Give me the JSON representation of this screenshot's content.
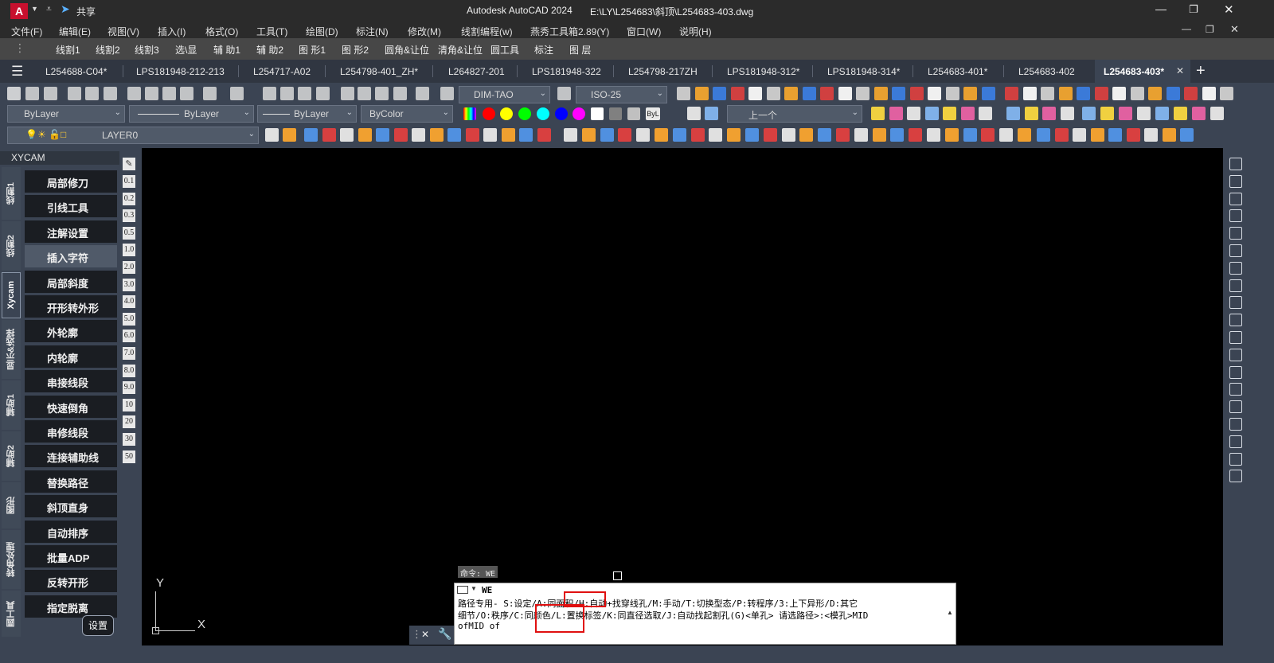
{
  "app": {
    "logo": "A",
    "share": "共享",
    "title": "Autodesk AutoCAD 2024",
    "path": "E:\\LY\\L254683\\斜顶\\L254683-403.dwg"
  },
  "menu": [
    "文件(F)",
    "编辑(E)",
    "视图(V)",
    "插入(I)",
    "格式(O)",
    "工具(T)",
    "绘图(D)",
    "标注(N)",
    "修改(M)",
    "线割编程(w)",
    "燕秀工具箱2.89(Y)",
    "窗口(W)",
    "说明(H)"
  ],
  "xy_toolbar": [
    "线割1",
    "线割2",
    "线割3",
    "选\\显",
    "辅 助1",
    "辅 助2",
    "图 形1",
    "图 形2",
    "圆角&让位",
    "清角&让位",
    "圆工具",
    "标注",
    "图 层"
  ],
  "tabs": [
    "L254688-C04*",
    "LPS181948-212-213",
    "L254717-A02",
    "L254798-401_ZH*",
    "L264827-201",
    "LPS181948-322",
    "L254798-217ZH",
    "LPS181948-312*",
    "LPS181948-314*",
    "L254683-401*",
    "L254683-402",
    "L254683-403*"
  ],
  "active_tab_index": 11,
  "styles": {
    "dim_style": "DIM-TAO",
    "text_style": "ISO-25"
  },
  "properties": {
    "layer_prop": "ByLayer",
    "linetype": "ByLayer",
    "lineweight": "ByLayer",
    "color": "ByColor",
    "layer": "LAYER0",
    "prev_view": "上一个"
  },
  "palette_colors": [
    "#ff0000",
    "#ffff00",
    "#00ff00",
    "#00ffff",
    "#0000ff",
    "#ff00ff",
    "#ffffff",
    "#808080",
    "#c0c0c0"
  ],
  "palette_label": "ByL",
  "panel": {
    "title": "XYCAM",
    "vertical_tabs": [
      "线割1",
      "线割2",
      "Xycam",
      "显示&选择",
      "辅助1",
      "辅助2",
      "图形",
      "转角处理",
      "圆工具"
    ],
    "active_vertical_tab": 2,
    "buttons": [
      "局部修刀",
      "引线工具",
      "注解设置",
      "插入字符",
      "局部斜度",
      "开形转外形",
      "外轮廓",
      "内轮廓",
      "串接线段",
      "快速倒角",
      "串修线段",
      "连接辅助线",
      "替换路径",
      "斜顶直身",
      "自动排序",
      "批量ADP",
      "反转开形",
      "指定脱离"
    ],
    "highlighted_button": 3,
    "settings_button": "设置",
    "offsets": [
      "0.1",
      "0.2",
      "0.3",
      "0.5",
      "1.0",
      "2.0",
      "3.0",
      "4.0",
      "5.0",
      "6.0",
      "7.0",
      "8.0",
      "9.0",
      "10",
      "20",
      "30",
      "50"
    ]
  },
  "ucs": {
    "y": "Y",
    "x": "X"
  },
  "command": {
    "tooltip": "命令: WE",
    "input": "WE",
    "line1": "路径专用- S:设定/A:同面积/H:自动+找穿线孔/M:手动/T:切换型态/P:转程序/3:上下异形/D:其它",
    "line2": "细节/O:秩序/C:同颜色/L:置换标签/K:同直径选取/J:自动找起割孔(G)<单孔> 请选路径>:<模孔>MID",
    "line3": "ofMID of"
  }
}
